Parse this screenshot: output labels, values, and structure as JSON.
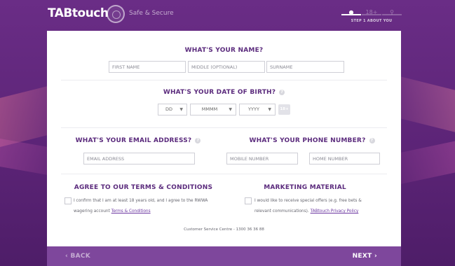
{
  "header": {
    "logo_text": "TABtouch",
    "secure_label": "Safe & Secure",
    "steps": [
      {
        "icon": "person-icon",
        "glyph": "●"
      },
      {
        "icon": "age-icon",
        "glyph": "18+"
      },
      {
        "icon": "key-icon",
        "glyph": "⚲"
      }
    ],
    "step_label": "STEP 1 ABOUT YOU"
  },
  "name_section": {
    "heading": "WHAT'S YOUR NAME?",
    "first_placeholder": "FIRST NAME",
    "middle_placeholder": "MIDDLE (OPTIONAL)",
    "surname_placeholder": "SURNAME"
  },
  "dob_section": {
    "heading": "WHAT'S YOUR DATE OF BIRTH?",
    "info_glyph": "?",
    "day": "DD",
    "month": "MMMM",
    "year": "YYYY",
    "age_badge": "18+"
  },
  "email_section": {
    "heading": "WHAT'S YOUR EMAIL ADDRESS?",
    "info_glyph": "?",
    "email_placeholder": "EMAIL ADDRESS"
  },
  "phone_section": {
    "heading": "WHAT'S YOUR PHONE NUMBER?",
    "info_glyph": "?",
    "mobile_placeholder": "MOBILE NUMBER",
    "home_placeholder": "HOME NUMBER"
  },
  "terms_section": {
    "heading": "AGREE TO OUR TERMS & CONDITIONS",
    "text_line1": "I confirm that I am at least 18 years old, and I agree to the RWWA",
    "text_line2": "wagering account",
    "link": "Terms & Conditions"
  },
  "marketing_section": {
    "heading": "MARKETING MATERIAL",
    "text_line1": "I would like to receive special offers (e.g. free bets &",
    "text_line2": "relevant communications).",
    "link": "TABtouch Privacy Policy"
  },
  "footer": {
    "service_text": "Customer Service Centre - 1300 36 36 88"
  },
  "nav": {
    "back_label": "‹  BACK",
    "next_label": "NEXT  ›"
  },
  "colors": {
    "brand_purple": "#5b2b7d",
    "background": "#6a2d86",
    "nav_bar": "#7e479c"
  }
}
